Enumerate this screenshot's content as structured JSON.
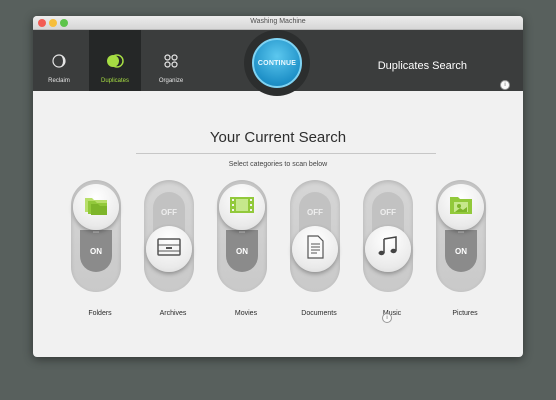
{
  "window": {
    "title": "Washing Machine"
  },
  "nav": [
    {
      "label": "Reclaim",
      "icon": "reclaim-moon-icon",
      "active": false
    },
    {
      "label": "Duplicates",
      "icon": "duplicates-circles-icon",
      "active": true
    },
    {
      "label": "Organize",
      "icon": "organize-grid-icon",
      "active": false
    }
  ],
  "continue_label": "CONTINUE",
  "header_title": "Duplicates Search",
  "search": {
    "title": "Your Current Search",
    "subtitle": "Select categories to scan below"
  },
  "categories": [
    {
      "label": "Folders",
      "state": "ON",
      "icon": "folders-icon"
    },
    {
      "label": "Archives",
      "state": "OFF",
      "icon": "archive-cabinet-icon"
    },
    {
      "label": "Movies",
      "state": "ON",
      "icon": "film-strip-icon"
    },
    {
      "label": "Documents",
      "state": "OFF",
      "icon": "document-icon"
    },
    {
      "label": "Music",
      "state": "OFF",
      "icon": "music-note-icon"
    },
    {
      "label": "Pictures",
      "state": "ON",
      "icon": "pictures-folder-icon"
    }
  ],
  "info_glyph": "i",
  "colors": {
    "accent_green": "#a6dd43",
    "continue_blue": "#1f91c8",
    "header_dark": "#3b3d3d"
  }
}
